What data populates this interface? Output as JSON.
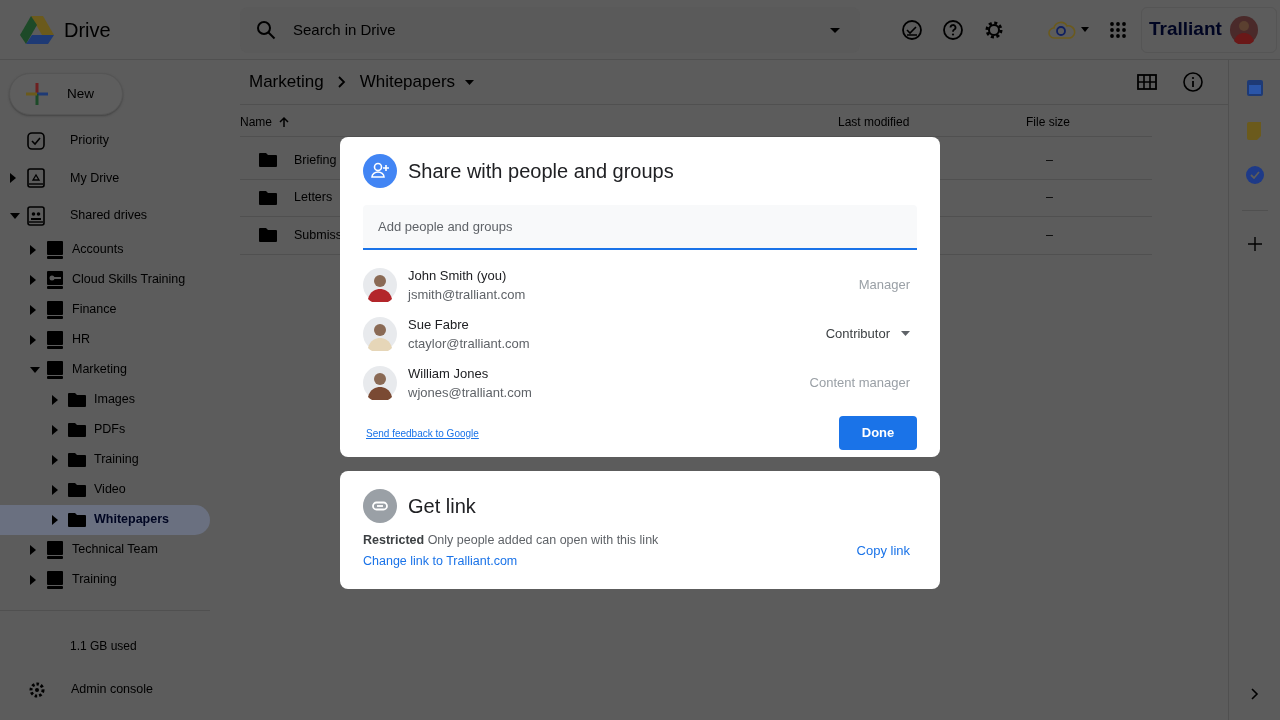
{
  "topbar": {
    "product": "Drive",
    "search": {
      "placeholder": "Search in Drive"
    },
    "brand": "Tralliant"
  },
  "sidebar": {
    "new_button": "New",
    "items": [
      {
        "label": "Priority",
        "kind": "priority",
        "selected": false
      },
      {
        "label": "My Drive",
        "kind": "mydrive",
        "expanded": false,
        "selected": false,
        "has_toggle": true
      },
      {
        "label": "Shared drives",
        "kind": "shared",
        "expanded": true,
        "selected": false,
        "has_toggle": true,
        "children": [
          {
            "label": "Accounts",
            "kind": "drive",
            "expanded": false,
            "selected": false,
            "has_toggle": true
          },
          {
            "label": "Cloud Skills Training",
            "kind": "keydrive",
            "expanded": false,
            "selected": false,
            "has_toggle": true
          },
          {
            "label": "Finance",
            "kind": "drive",
            "expanded": false,
            "selected": false,
            "has_toggle": true
          },
          {
            "label": "HR",
            "kind": "drive",
            "expanded": false,
            "selected": false,
            "has_toggle": true
          },
          {
            "label": "Marketing",
            "kind": "drive",
            "expanded": true,
            "selected": false,
            "has_toggle": true,
            "children": [
              {
                "label": "Images",
                "kind": "folder",
                "expanded": false,
                "selected": false,
                "has_toggle": true
              },
              {
                "label": "PDFs",
                "kind": "folder",
                "expanded": false,
                "selected": false,
                "has_toggle": true
              },
              {
                "label": "Training",
                "kind": "folder",
                "expanded": false,
                "selected": false,
                "has_toggle": true
              },
              {
                "label": "Video",
                "kind": "folder",
                "expanded": false,
                "selected": false,
                "has_toggle": true
              },
              {
                "label": "Whitepapers",
                "kind": "folder",
                "expanded": false,
                "selected": true,
                "has_toggle": true
              }
            ]
          },
          {
            "label": "Technical Team",
            "kind": "drive",
            "expanded": false,
            "selected": false,
            "has_toggle": true
          },
          {
            "label": "Training",
            "kind": "drive",
            "expanded": false,
            "selected": false,
            "has_toggle": true
          }
        ]
      }
    ],
    "storage": "1.1 GB used",
    "admin": "Admin console"
  },
  "breadcrumb": [
    "Marketing",
    "Whitepapers"
  ],
  "table": {
    "columns": [
      "Name",
      "Last modified",
      "File size"
    ],
    "rows": [
      {
        "name": "Briefing",
        "size": "–"
      },
      {
        "name": "Letters",
        "size": "–"
      },
      {
        "name": "Submiss",
        "size": "–"
      }
    ]
  },
  "share_dialog": {
    "title": "Share with people and groups",
    "input": {
      "placeholder": "Add people and groups"
    },
    "people": [
      {
        "name": "John Smith (you)",
        "email": "jsmith@tralliant.com",
        "role": "Manager",
        "disabled": true,
        "color": "#b3262b"
      },
      {
        "name": "Sue Fabre",
        "email": "ctaylor@tralliant.com",
        "role": "Contributor",
        "disabled": false,
        "color": "#e6d6b8"
      },
      {
        "name": "William Jones",
        "email": "wjones@tralliant.com",
        "role": "Content manager",
        "disabled": true,
        "color": "#7a4a33"
      }
    ],
    "feedback": "Send feedback to Google",
    "done": "Done"
  },
  "link_dialog": {
    "title": "Get link",
    "restriction": "Restricted",
    "description": "Only people added can open with this link",
    "change": "Change link to Tralliant.com",
    "copy": "Copy link"
  }
}
